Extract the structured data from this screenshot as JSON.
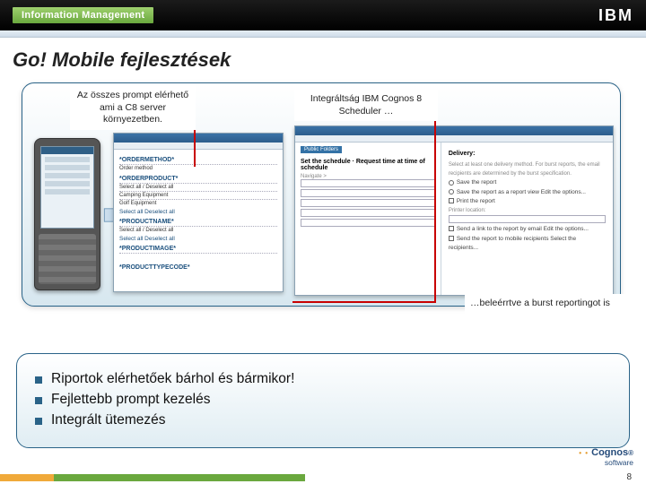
{
  "topbar": {
    "badge": "Information Management",
    "logo": "IBM"
  },
  "title": "Go! Mobile fejlesztések",
  "callouts": {
    "c1": "Az összes prompt elérhető ami a C8 server környezetben.",
    "c2": "Integráltság IBM Cognos 8 Scheduler …",
    "c3": "…beleérrtve a burst reportingot is"
  },
  "prompt_list": {
    "h1": "*ORDERMETHOD*",
    "r1": "Order method",
    "h2": "*ORDERPRODUCT*",
    "r2a": "Select all / Deselect all",
    "r2b": "Camping Equipment",
    "r2c": "Golf Equipment",
    "l1": "Select all  Deselect all",
    "h3": "*PRODUCTNAME*",
    "r3": "Select all / Deselect all",
    "h4": "*PRODUCTIMAGE*",
    "h5": "*PRODUCTTYPECODE*"
  },
  "sched": {
    "left_tag": "Public Folders",
    "left_head": "Set the schedule · Request time at time of schedule",
    "nav": "Navigate >",
    "right_head": "Delivery:",
    "r1": "Select at least one delivery method. For burst reports, the email recipients are determined by the burst specification.",
    "r2": "Save the report",
    "r3": "Save the report as a report view   Edit the options...",
    "r4": "Print the report",
    "r5": "Printer location:",
    "r6": "Send a link to the report by email   Edit the options...",
    "r7": "Send the report to mobile recipients   Select the recipients..."
  },
  "bullets": {
    "b1": "Riportok elérhetőek bárhol és bármikor!",
    "b2": "Fejlettebb prompt kezelés",
    "b3": "Integrált ütemezés"
  },
  "footer": {
    "brand": "Cognos",
    "sub": "software",
    "page": "8"
  }
}
